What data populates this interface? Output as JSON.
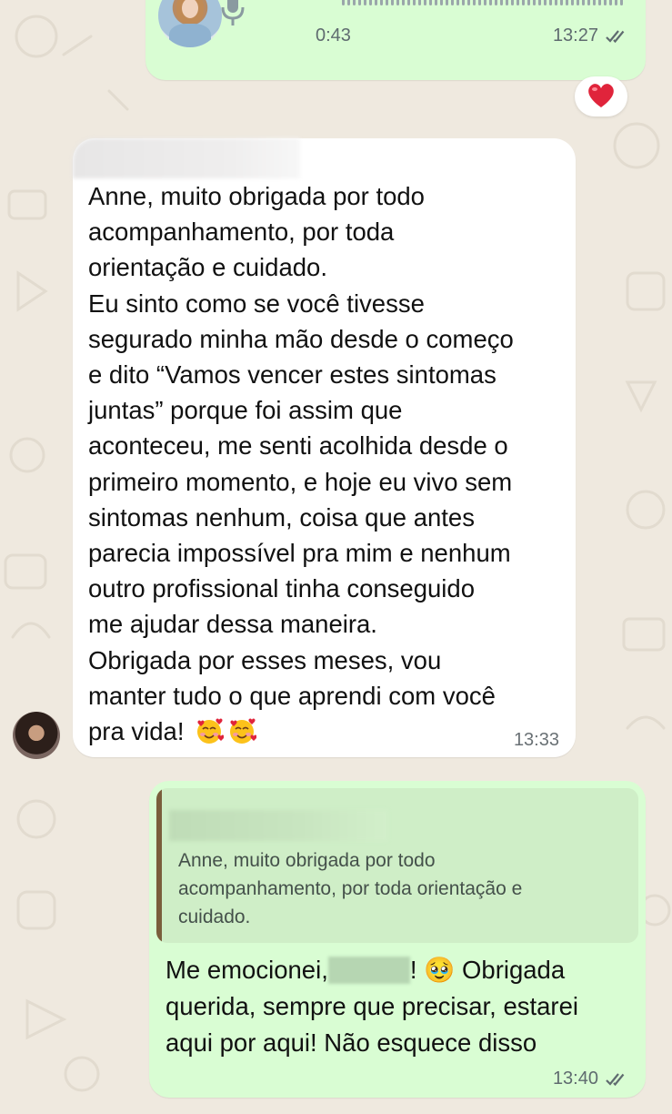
{
  "voice_message": {
    "duration": "0:43",
    "time": "13:27",
    "status": "read"
  },
  "reaction": {
    "emoji": "heart-icon"
  },
  "incoming_message": {
    "text_part1": "Anne, muito obrigada por todo\nacompanhamento, por toda\norientação e cuidado.\nEu sinto como se você tivesse\nsegurado minha mão desde o começo\ne dito “Vamos vencer estes sintomas\njuntas” porque foi assim que\naconteceu, me senti acolhida desde o\nprimeiro momento, e hoje eu vivo sem\nsintomas nenhum, coisa que antes\nparecia impossível pra mim e nenhum\noutro profissional tinha conseguido\nme ajudar dessa maneira.\nObrigada por esses meses, vou\nmanter tudo o que aprendi com você\npra vida!",
    "time": "13:33"
  },
  "reply_message": {
    "quoted_text": "Anne, muito obrigada por todo\nacompanhamento, por toda orientação e\ncuidado.",
    "text_before_name": "Me emocionei,",
    "text_after_name": "! 🥹 Obrigada\nquerida, sempre que precisar, estarei\naqui por aqui! Não esquece disso",
    "time": "13:40",
    "status": "read"
  },
  "colors": {
    "wallpaper": "#efe9df",
    "outgoing_bubble": "#d9fdd3",
    "incoming_bubble": "#ffffff",
    "quote_bar": "#7a5e3c"
  }
}
